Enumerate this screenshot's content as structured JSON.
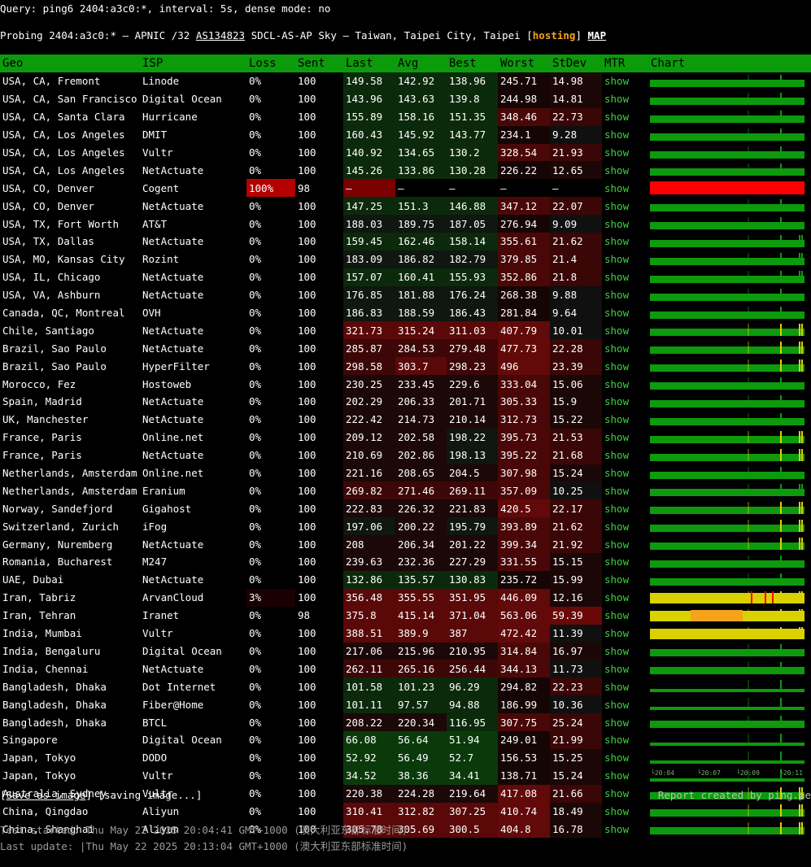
{
  "query": "Query: ping6 2404:a3c0:*, interval: 5s, dense mode: no",
  "probing": {
    "prefix": "Probing 2404:a3c0:* – APNIC /32 ",
    "asn": "AS134823",
    "middle": " SDCL-AS-AP Sky – Taiwan, Taipei City, Taipei [",
    "tag": "hosting",
    "close": "] ",
    "map": "MAP"
  },
  "columns": [
    "Geo",
    "ISP",
    "Loss",
    "Sent",
    "Last",
    "Avg",
    "Best",
    "Worst",
    "StDev",
    "MTR",
    "Chart"
  ],
  "mtr_label": "show",
  "colors": {
    "header": "#0b9b0b",
    "ok_green": "#0d9a0d",
    "dead_red": "#ff0000",
    "yellow": "#d9d200",
    "orange": "#f7a21b"
  },
  "rows": [
    [
      "USA, CA, Fremont",
      "Linode",
      "0%",
      "100",
      "149.58",
      "142.92",
      "138.96",
      "245.71",
      "14.98"
    ],
    [
      "USA, CA, San Francisco",
      "Digital Ocean",
      "0%",
      "100",
      "143.96",
      "143.63",
      "139.8",
      "244.98",
      "14.81"
    ],
    [
      "USA, CA, Santa Clara",
      "Hurricane",
      "0%",
      "100",
      "155.89",
      "158.16",
      "151.35",
      "348.46",
      "22.73"
    ],
    [
      "USA, CA, Los Angeles",
      "DMIT",
      "0%",
      "100",
      "160.43",
      "145.92",
      "143.77",
      "234.1",
      "9.28"
    ],
    [
      "USA, CA, Los Angeles",
      "Vultr",
      "0%",
      "100",
      "140.92",
      "134.65",
      "130.2",
      "328.54",
      "21.93"
    ],
    [
      "USA, CA, Los Angeles",
      "NetActuate",
      "0%",
      "100",
      "145.26",
      "133.86",
      "130.28",
      "226.22",
      "12.65"
    ],
    [
      "USA, CO, Denver",
      "Cogent",
      "100%",
      "98",
      "–",
      "–",
      "–",
      "–",
      "–"
    ],
    [
      "USA, CO, Denver",
      "NetActuate",
      "0%",
      "100",
      "147.25",
      "151.3",
      "146.88",
      "347.12",
      "22.07"
    ],
    [
      "USA, TX, Fort Worth",
      "AT&T",
      "0%",
      "100",
      "188.03",
      "189.75",
      "187.05",
      "276.94",
      "9.09"
    ],
    [
      "USA, TX, Dallas",
      "NetActuate",
      "0%",
      "100",
      "159.45",
      "162.46",
      "158.14",
      "355.61",
      "21.62"
    ],
    [
      "USA, MO, Kansas City",
      "Rozint",
      "0%",
      "100",
      "183.09",
      "186.82",
      "182.79",
      "379.85",
      "21.4"
    ],
    [
      "USA, IL, Chicago",
      "NetActuate",
      "0%",
      "100",
      "157.07",
      "160.41",
      "155.93",
      "352.86",
      "21.8"
    ],
    [
      "USA, VA, Ashburn",
      "NetActuate",
      "0%",
      "100",
      "176.85",
      "181.88",
      "176.24",
      "268.38",
      "9.88"
    ],
    [
      "Canada, QC, Montreal",
      "OVH",
      "0%",
      "100",
      "186.83",
      "188.59",
      "186.43",
      "281.84",
      "9.64"
    ],
    [
      "Chile, Santiago",
      "NetActuate",
      "0%",
      "100",
      "321.73",
      "315.24",
      "311.03",
      "407.79",
      "10.01"
    ],
    [
      "Brazil, Sao Paulo",
      "NetActuate",
      "0%",
      "100",
      "285.87",
      "284.53",
      "279.48",
      "477.73",
      "22.28"
    ],
    [
      "Brazil, Sao Paulo",
      "HyperFilter",
      "0%",
      "100",
      "298.58",
      "303.7",
      "298.23",
      "496",
      "23.39"
    ],
    [
      "Morocco, Fez",
      "Hostoweb",
      "0%",
      "100",
      "230.25",
      "233.45",
      "229.6",
      "333.04",
      "15.06"
    ],
    [
      "Spain, Madrid",
      "NetActuate",
      "0%",
      "100",
      "202.29",
      "206.33",
      "201.71",
      "305.33",
      "15.9"
    ],
    [
      "UK, Manchester",
      "NetActuate",
      "0%",
      "100",
      "222.42",
      "214.73",
      "210.14",
      "312.73",
      "15.22"
    ],
    [
      "France, Paris",
      "Online.net",
      "0%",
      "100",
      "209.12",
      "202.58",
      "198.22",
      "395.73",
      "21.53"
    ],
    [
      "France, Paris",
      "NetActuate",
      "0%",
      "100",
      "210.69",
      "202.86",
      "198.13",
      "395.22",
      "21.68"
    ],
    [
      "Netherlands, Amsterdam",
      "Online.net",
      "0%",
      "100",
      "221.16",
      "208.65",
      "204.5",
      "307.98",
      "15.24"
    ],
    [
      "Netherlands, Amsterdam",
      "Eranium",
      "0%",
      "100",
      "269.82",
      "271.46",
      "269.11",
      "357.09",
      "10.25"
    ],
    [
      "Norway, Sandefjord",
      "Gigahost",
      "0%",
      "100",
      "222.83",
      "226.32",
      "221.83",
      "420.5",
      "22.17"
    ],
    [
      "Switzerland, Zurich",
      "iFog",
      "0%",
      "100",
      "197.06",
      "200.22",
      "195.79",
      "393.89",
      "21.62"
    ],
    [
      "Germany, Nuremberg",
      "NetActuate",
      "0%",
      "100",
      "208",
      "206.34",
      "201.22",
      "399.34",
      "21.92"
    ],
    [
      "Romania, Bucharest",
      "M247",
      "0%",
      "100",
      "239.63",
      "232.36",
      "227.29",
      "331.55",
      "15.15"
    ],
    [
      "UAE, Dubai",
      "NetActuate",
      "0%",
      "100",
      "132.86",
      "135.57",
      "130.83",
      "235.72",
      "15.99"
    ],
    [
      "Iran, Tabriz",
      "ArvanCloud",
      "3%",
      "100",
      "356.48",
      "355.55",
      "351.95",
      "446.09",
      "12.16"
    ],
    [
      "Iran, Tehran",
      "Iranet",
      "0%",
      "98",
      "375.8",
      "415.14",
      "371.04",
      "563.06",
      "59.39"
    ],
    [
      "India, Mumbai",
      "Vultr",
      "0%",
      "100",
      "388.51",
      "389.9",
      "387",
      "472.42",
      "11.39"
    ],
    [
      "India, Bengaluru",
      "Digital Ocean",
      "0%",
      "100",
      "217.06",
      "215.96",
      "210.95",
      "314.84",
      "16.97"
    ],
    [
      "India, Chennai",
      "NetActuate",
      "0%",
      "100",
      "262.11",
      "265.16",
      "256.44",
      "344.13",
      "11.73"
    ],
    [
      "Bangladesh, Dhaka",
      "Dot Internet",
      "0%",
      "100",
      "101.58",
      "101.23",
      "96.29",
      "294.82",
      "22.23"
    ],
    [
      "Bangladesh, Dhaka",
      "Fiber@Home",
      "0%",
      "100",
      "101.11",
      "97.57",
      "94.88",
      "186.99",
      "10.36"
    ],
    [
      "Bangladesh, Dhaka",
      "BTCL",
      "0%",
      "100",
      "208.22",
      "220.34",
      "116.95",
      "307.75",
      "25.24"
    ],
    [
      "Singapore",
      "Digital Ocean",
      "0%",
      "100",
      "66.08",
      "56.64",
      "51.94",
      "249.01",
      "21.99"
    ],
    [
      "Japan, Tokyo",
      "DODO",
      "0%",
      "100",
      "52.92",
      "56.49",
      "52.7",
      "156.53",
      "15.25"
    ],
    [
      "Japan, Tokyo",
      "Vultr",
      "0%",
      "100",
      "34.52",
      "38.36",
      "34.41",
      "138.71",
      "15.24"
    ],
    [
      "Australia, Sydney",
      "Vultr",
      "0%",
      "100",
      "220.38",
      "224.28",
      "219.64",
      "417.08",
      "21.66"
    ],
    [
      "China, Qingdao",
      "Aliyun",
      "0%",
      "100",
      "310.41",
      "312.82",
      "307.25",
      "410.74",
      "18.49"
    ],
    [
      "China, Shanghai",
      "Aliyun",
      "0%",
      "100",
      "305.78",
      "305.69",
      "300.5",
      "404.8",
      "16.78"
    ]
  ],
  "time_ticks": [
    "└20:04",
    "└20:07",
    "└20:09",
    "└20:11"
  ],
  "footer": {
    "save_open": "[",
    "save_link": "Save as image",
    "save_close": "] [saving image...]",
    "credit": "Report created by ping.pe",
    "started": "Test started: Thu May 22 2025 20:04:41 GMT+1000 (澳大利亚东部标准时间)",
    "updated": "Last update: |Thu May 22 2025 20:13:04 GMT+1000 (澳大利亚东部标准时间)"
  }
}
